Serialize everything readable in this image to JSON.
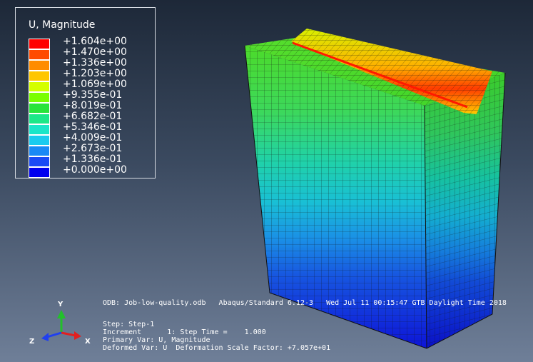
{
  "legend": {
    "title": "U, Magnitude",
    "entries": [
      {
        "value": "+1.604e+00",
        "color": "#ff0000"
      },
      {
        "value": "+1.470e+00",
        "color": "#ff4a00"
      },
      {
        "value": "+1.336e+00",
        "color": "#ff8c00"
      },
      {
        "value": "+1.203e+00",
        "color": "#ffc600"
      },
      {
        "value": "+1.069e+00",
        "color": "#d4ff00"
      },
      {
        "value": "+9.355e-01",
        "color": "#7aff00"
      },
      {
        "value": "+8.019e-01",
        "color": "#28e43a"
      },
      {
        "value": "+6.682e-01",
        "color": "#1ce888"
      },
      {
        "value": "+5.346e-01",
        "color": "#1ae6c8"
      },
      {
        "value": "+4.009e-01",
        "color": "#1acbef"
      },
      {
        "value": "+2.673e-01",
        "color": "#1a89f5"
      },
      {
        "value": "+1.336e-01",
        "color": "#1a4af5"
      },
      {
        "value": "+0.000e+00",
        "color": "#0000ee"
      }
    ]
  },
  "info": {
    "odb_line": "ODB: Job-low-quality.odb   Abaqus/Standard 6.12-3   Wed Jul 11 00:15:47 GTB Daylight Time 2018",
    "step_line": "Step: Step-1",
    "increment_line": "Increment      1: Step Time =    1.000",
    "primary_var_line": "Primary Var: U, Magnitude",
    "deformed_var_line": "Deformed Var: U  Deformation Scale Factor: +7.057e+01"
  },
  "triad": {
    "x": "X",
    "y": "Y",
    "z": "Z"
  },
  "colors": {
    "background_top": "#1d2838",
    "background_bottom": "#6f7f98",
    "mesh_lines": "#1a1a1a"
  }
}
